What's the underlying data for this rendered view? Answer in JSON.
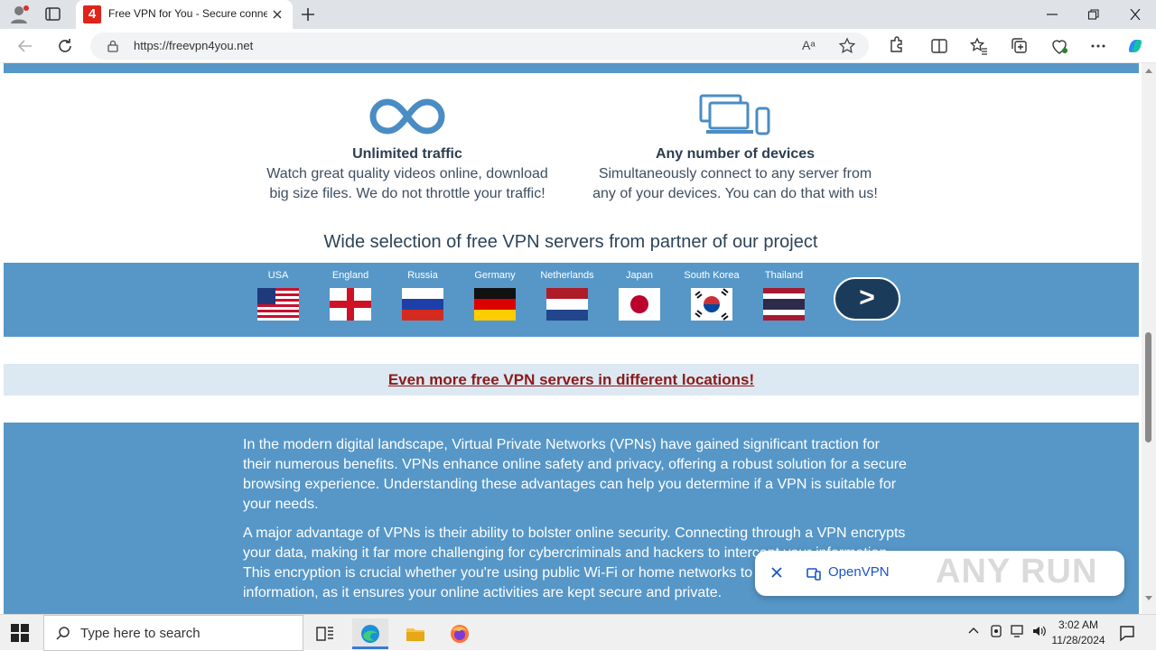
{
  "browser": {
    "tab_title": "Free VPN for You - Secure conne",
    "tab_favicon_char": "4",
    "url": "https://freevpn4you.net",
    "read_aloud_label": "Aᵃ"
  },
  "features": [
    {
      "title": "Unlimited traffic",
      "desc_line1": "Watch great quality videos online, download",
      "desc_line2": "big size files. We do not throttle your traffic!",
      "icon": "infinity-icon"
    },
    {
      "title": "Any number of devices",
      "desc_line1": "Simultaneously connect to any server from",
      "desc_line2": "any of your devices. You can do that with us!",
      "icon": "devices-icon"
    }
  ],
  "servers": {
    "heading": "Wide selection of free VPN servers from partner of our project",
    "countries": [
      "USA",
      "England",
      "Russia",
      "Germany",
      "Netherlands",
      "Japan",
      "South Korea",
      "Thailand"
    ],
    "next_label": ">"
  },
  "more_link": "Even more free VPN servers in different locations!",
  "article": {
    "p1": "In the modern digital landscape, Virtual Private Networks (VPNs) have gained significant traction for their numerous benefits. VPNs enhance online safety and privacy, offering a robust solution for a secure browsing experience. Understanding these advantages can help you determine if a VPN is suitable for your needs.",
    "p2": "A major advantage of VPNs is their ability to bolster online security. Connecting through a VPN encrypts your data, making it far more challenging for cybercriminals and hackers to intercept your information. This encryption is crucial whether you're using public Wi-Fi or home networks to protect sensitive information, as it ensures your online activities are kept secure and private."
  },
  "toast": {
    "label": "OpenVPN",
    "watermark": "ANY RUN"
  },
  "taskbar": {
    "search_placeholder": "Type here to search",
    "time": "3:02 AM",
    "date": "11/28/2024"
  },
  "colors": {
    "accent_blue": "#5697c8",
    "heading_dark": "#2c3e50",
    "link_red": "#8b1a1a",
    "next_button": "#1b3b5a"
  }
}
